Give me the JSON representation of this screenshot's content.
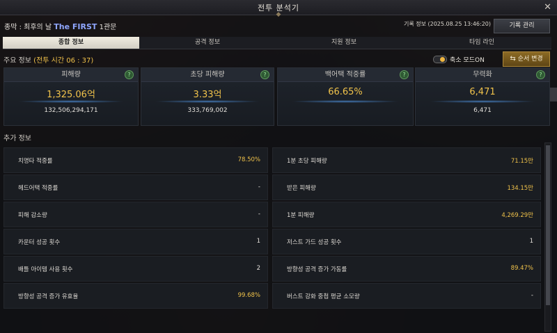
{
  "window": {
    "title": "전투 분석기",
    "close": "✕",
    "title_ornament": "◆"
  },
  "header": {
    "prefix": "종막 : 최후의 날 ",
    "boss": "The FIRST",
    "suffix": " 1관문",
    "record_info": "기록 정보 (2025.08.25 13:46:20)",
    "record_button": "기록 관리"
  },
  "tabs": [
    {
      "label": "종합 정보",
      "active": true
    },
    {
      "label": "공격 정보",
      "active": false
    },
    {
      "label": "지원 정보",
      "active": false
    },
    {
      "label": "타임 라인",
      "active": false
    }
  ],
  "main_info": {
    "label": "주요 정보",
    "time": "(전투 시간 06 : 37)",
    "toggle_label": "축소 모드ON",
    "toggle_on": true,
    "order_button": "순서 변경",
    "order_icon": "⇆"
  },
  "stats": [
    {
      "title": "피해량",
      "value": "1,325.06억",
      "raw": "132,506,294,171"
    },
    {
      "title": "초당 피해량",
      "value": "3.33억",
      "raw": "333,769,002"
    },
    {
      "title": "백어택 적중률",
      "value": "66.65%",
      "raw": ""
    },
    {
      "title": "무력화",
      "value": "6,471",
      "raw": "6,471"
    }
  ],
  "help_icon": "?",
  "extra": {
    "label": "추가 정보",
    "rows": [
      {
        "left": {
          "label": "치명타 적중률",
          "value": "78.50%"
        },
        "right": {
          "label": "1분 초당 피해량",
          "value": "71.15만"
        }
      },
      {
        "left": {
          "label": "헤드어택 적중률",
          "value": "-"
        },
        "right": {
          "label": "받은 피해량",
          "value": "134.15만"
        }
      },
      {
        "left": {
          "label": "피해 감소량",
          "value": "-"
        },
        "right": {
          "label": "1분 피해량",
          "value": "4,269.29만"
        }
      },
      {
        "left": {
          "label": "카운터 성공 횟수",
          "value": "1"
        },
        "right": {
          "label": "저스트 가드 성공 횟수",
          "value": "1"
        }
      },
      {
        "left": {
          "label": "배틀 아이템 사용 횟수",
          "value": "2"
        },
        "right": {
          "label": "방향성 공격 증가 가동률",
          "value": "89.47%"
        }
      },
      {
        "left": {
          "label": "방향성 공격 증가 유효율",
          "value": "99.68%"
        },
        "right": {
          "label": "버스트 강화 중첩 평균 소모량",
          "value": "-"
        }
      }
    ]
  }
}
